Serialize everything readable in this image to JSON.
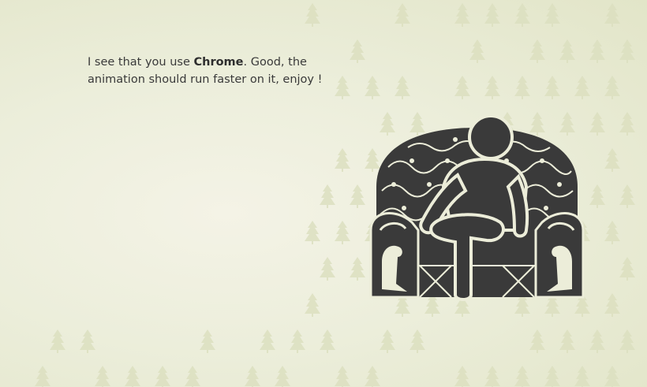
{
  "message": {
    "before": "I see that you use ",
    "browser": "Chrome",
    "after": ". Good, the animation should run faster on it, enjoy !"
  },
  "colors": {
    "background": "#eceedb",
    "tree_pattern": "#d9dbbd",
    "figure": "#3a3a3a",
    "text": "#3a3a3a"
  },
  "icons": {
    "background_pattern": "pine-tree-icon",
    "illustration": "person-in-armchair-icon"
  }
}
